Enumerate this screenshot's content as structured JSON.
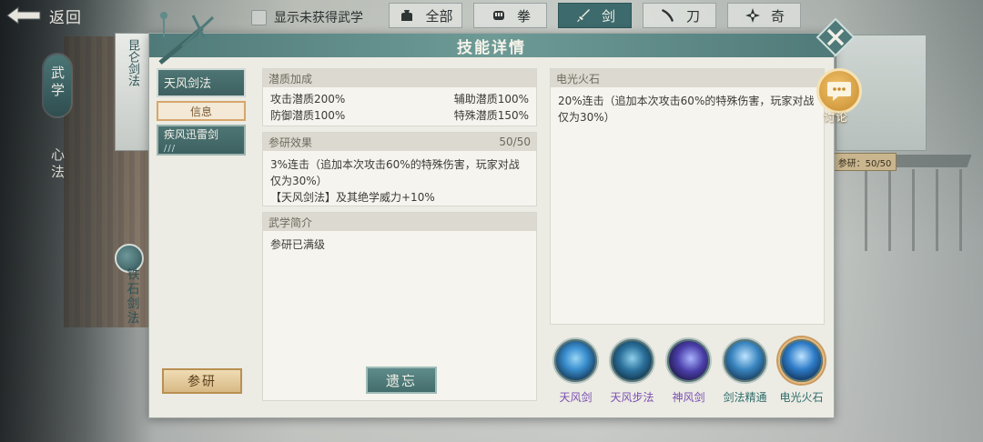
{
  "top": {
    "back_label": "返回",
    "filter_label": "显示未获得武学",
    "tabs": [
      {
        "label": "全部",
        "icon": "bag-icon",
        "active": false
      },
      {
        "label": "拳",
        "icon": "fist-icon",
        "active": false
      },
      {
        "label": "剑",
        "icon": "sword-icon",
        "active": true
      },
      {
        "label": "刀",
        "icon": "blade-icon",
        "active": false
      },
      {
        "label": "奇",
        "icon": "shuriken-icon",
        "active": false
      }
    ]
  },
  "sidebar": {
    "wuxue": "武学",
    "xinfa": "心法",
    "card1": "昆仑剑法",
    "card2": "铁石剑法"
  },
  "dialog": {
    "title": "技能详情",
    "skills": [
      {
        "name": "天风剑法",
        "sub": "信息"
      },
      {
        "name": "疾风迅雷剑",
        "marks": "///"
      }
    ],
    "research_label": "参研",
    "forget_label": "遗忘",
    "potential": {
      "header": "潜质加成",
      "items": [
        {
          "left": "攻击潜质200%",
          "right": "辅助潜质100%"
        },
        {
          "left": "防御潜质100%",
          "right": "特殊潜质150%"
        }
      ]
    },
    "research_effect": {
      "header": "参研效果",
      "progress": "50/50",
      "line1": "3%连击（追加本次攻击60%的特殊伤害，玩家对战仅为30%）",
      "line2": "【天风剑法】及其绝学威力+10%"
    },
    "intro": {
      "header": "武学简介",
      "text": "参研已满级"
    },
    "detail": {
      "header": "电光火石",
      "text": "20%连击（追加本次攻击60%的特殊伤害，玩家对战仅为30%）"
    },
    "skill_icons": [
      {
        "name": "天风剑",
        "color": "#3a8fd0"
      },
      {
        "name": "天风步法",
        "color": "#2a6f9a"
      },
      {
        "name": "神风剑",
        "color": "#4a3ea8"
      },
      {
        "name": "剑法精通",
        "color": "#3a86c0"
      },
      {
        "name": "电光火石",
        "color": "#2e7cc8"
      }
    ]
  },
  "discuss_label": "讨论",
  "right_tag": "参研：50/50"
}
